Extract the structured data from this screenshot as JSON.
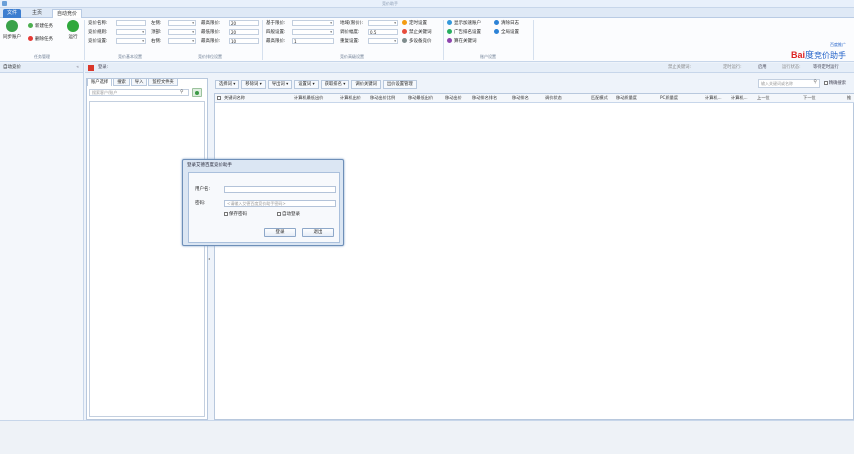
{
  "window": {
    "title": "竞价助手"
  },
  "tabs": {
    "file": "文件",
    "home": "主页",
    "auto_bid": "自动竞价"
  },
  "ribbon": {
    "sync_button": "同步账户",
    "new_task": "新建任务",
    "delete_task": "删除任务",
    "run_button": "运行",
    "group_task": "任务管理",
    "fields": {
      "bid_name": "竞价名称:",
      "bid_rule": "竞价规则:",
      "bid_setting": "竞价设置:",
      "left_label": "左侧:",
      "top_label": "顶部:",
      "right_label": "右侧:",
      "max_bid_1": "最高限价:",
      "max_bid_1_val": "20",
      "min_bid_1": "最低限价:",
      "min_bid_1_val": "20",
      "max_bid_2": "最高限价:",
      "max_bid_2_val": "10",
      "base_price": "基于限价:",
      "strategy": "四般设置:",
      "max_price": "最高限价:",
      "max_price_val": "1",
      "region": "地域(限价):",
      "adjust": "调价幅度:",
      "adjust_val": "0.5",
      "repeat": "重复设置:"
    },
    "group_basic": "竞价基本设置",
    "group_rank": "竞价排位设置",
    "group_advanced": "竞价高级设置",
    "timer": "定时设置",
    "disable_kw": "禁止关键词",
    "multi_bid": "多设备竞价",
    "show_new_account": "显示加速账户",
    "advertiser_set": "广告排名设置",
    "import_kw": "算在关键词",
    "clear_log": "清除日志",
    "global_set": "全局设置",
    "group_account": "账户设置"
  },
  "logo": {
    "small": "百度推广",
    "bai": "Bai",
    "du": "度",
    "name": "竞价助手"
  },
  "left_panel": {
    "title": "自动竞价"
  },
  "main_head": {
    "label": "登录:",
    "status_text": "禁止关键词:",
    "timer_label": "定时运行:",
    "timer_val": "启用",
    "run_status_label": "运行状态:",
    "run_status_val": "等待定时运行"
  },
  "account_tabs": [
    "账户选择",
    "搜索",
    "导入",
    "监控文件夹"
  ],
  "account_search": {
    "placeholder": "搜索客户/账户"
  },
  "keyword_toolbar": [
    "选择词",
    "移除词",
    "导出词",
    "设置词",
    "获取排名",
    "调价关键词",
    "出价设置管理"
  ],
  "filter": {
    "placeholder": "输入关键词或名称",
    "checkbox_label": "精确搜索"
  },
  "columns": [
    "关键词名称",
    "计算机最低出价",
    "计算机出价",
    "移动出价比例",
    "移动最低出价",
    "移动出价",
    "移动排名排名",
    "移动排名",
    "调价状态",
    "匹配模式",
    "移动质量度",
    "PC质量度",
    "计算机...",
    "计算机...",
    "上一位",
    "下一位",
    "推"
  ],
  "dialog": {
    "title": "登录艾德百度竞价助手",
    "user_label": "用户名:",
    "pwd_label": "密码:",
    "pwd_placeholder": "<请输入艾德百度竞价助手密码>",
    "remember": "保存密码",
    "auto_login": "自动登录",
    "login_btn": "登录",
    "exit_btn": "退出"
  }
}
